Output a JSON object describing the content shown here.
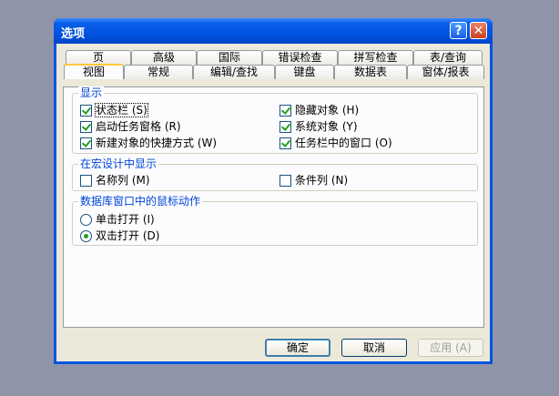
{
  "window": {
    "title": "选项",
    "help_glyph": "?",
    "close_glyph": "✕"
  },
  "tabs_row1": [
    "页",
    "高级",
    "国际",
    "错误检查",
    "拼写检查",
    "表/查询"
  ],
  "tabs_row2": [
    "视图",
    "常规",
    "编辑/查找",
    "键盘",
    "数据表",
    "窗体/报表"
  ],
  "groups": {
    "display": {
      "label": "显示"
    },
    "macro": {
      "label": "在宏设计中显示"
    },
    "mouse": {
      "label": "数据库窗口中的鼠标动作"
    }
  },
  "display_options": {
    "status_bar": {
      "label": "状态栏 (S)",
      "checked": true
    },
    "startup_pane": {
      "label": "启动任务窗格 (R)",
      "checked": true
    },
    "shortcut_new": {
      "label": "新建对象的快捷方式 (W)",
      "checked": true
    },
    "hidden_objects": {
      "label": "隐藏对象 (H)",
      "checked": true
    },
    "system_objects": {
      "label": "系统对象 (Y)",
      "checked": true
    },
    "taskbar_windows": {
      "label": "任务栏中的窗口 (O)",
      "checked": true
    }
  },
  "macro_options": {
    "names_col": {
      "label": "名称列 (M)",
      "checked": false
    },
    "conditions_col": {
      "label": "条件列 (N)",
      "checked": false
    }
  },
  "mouse_options": {
    "single_click": {
      "label": "单击打开 (I)",
      "selected": false
    },
    "double_click": {
      "label": "双击打开 (D)",
      "selected": true
    }
  },
  "buttons": {
    "ok": "确定",
    "cancel": "取消",
    "apply": "应用 (A)"
  }
}
